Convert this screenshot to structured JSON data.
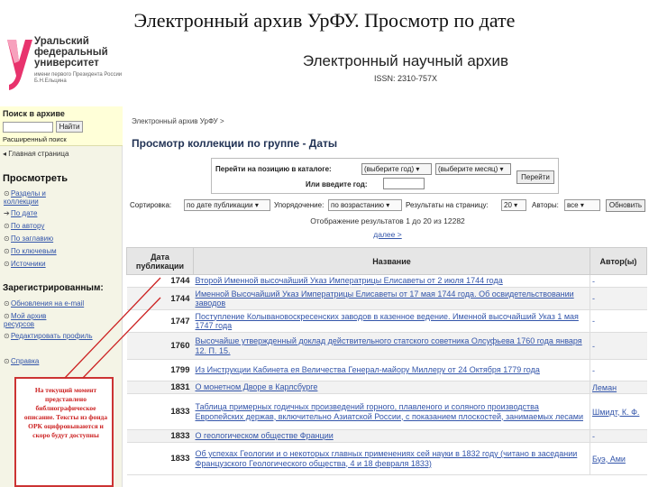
{
  "slide_title": "Электронный архив УрФУ. Просмотр по дате",
  "logo": {
    "lines": [
      "Уральский",
      "федеральный",
      "университет"
    ],
    "sub": "имени первого Президента России Б.Н.Ельцина"
  },
  "banner": {
    "name": "Электронный научный архив",
    "issn": "ISSN: 2310-757X"
  },
  "sidebar": {
    "search_heading": "Поиск в архиве",
    "search_button": "Найти",
    "advanced_search": "Расширенный поиск",
    "home": "Главная страница",
    "browse_heading": "Просмотреть",
    "browse_items": [
      "Разделы и коллекции",
      "По дате",
      "По автору",
      "По заглавию",
      "По ключевым",
      "Источники"
    ],
    "registered_heading": "Зарегистрированным:",
    "registered_items": [
      "Обновления на e-mail",
      "Мой архив ресурсов",
      "Редактировать профиль"
    ],
    "help": "Справка"
  },
  "note": "На текущий момент представлено библиографическое описание. Тексты из фонда ОРК оцифровываются и скоро будут доступны",
  "main": {
    "breadcrumb": "Электронный архив УрФУ >",
    "title": "Просмотр коллекции по группе - Даты",
    "jump": {
      "label_catalog": "Перейти на позицию в каталоге:",
      "year_select": "(выберите год)",
      "month_select": "(выберите месяц)",
      "label_enter": "Или введите год:",
      "go_button": "Перейти"
    },
    "sort": {
      "sort_label": "Сортировка:",
      "sort_value": "по дате публикации",
      "order_label": "Упорядочение:",
      "order_value": "по возрастанию",
      "perpage_label": "Результаты на страницу:",
      "perpage_value": "20",
      "author_label": "Авторы:",
      "author_value": "все",
      "update_button": "Обновить"
    },
    "summary": "Отображение результатов 1 до 20 из 12282",
    "next": "далее >",
    "headers": {
      "date": "Дата публикации",
      "title": "Название",
      "author": "Автор(ы)"
    },
    "rows": [
      {
        "date": "1744",
        "title": "Второй Именной высочайший Указ Императрицы Елисаветы от 2 июля 1744 года",
        "author": "-"
      },
      {
        "date": "1744",
        "title": "Именной Высочайший Указ Императрицы Елисаветы от 17 мая 1744 года. Об освидетельствовании заводов",
        "author": "-"
      },
      {
        "date": "1747",
        "title": "Поступление Колывановоскресенских заводов в казенное ведение. Именной высочайший Указ 1 мая 1747 года",
        "author": "-"
      },
      {
        "date": "1760",
        "title": "Высочайше утвержденный доклад действительного статского советника Олсуфьева 1760 года января 12. П. 15.",
        "author": "-"
      },
      {
        "date": "1799",
        "title": "Из Инструкции Кабинета ея Величества Генерал-майору Миллеру от 24 Октября 1779 года",
        "author": "-"
      },
      {
        "date": "1831",
        "title": "О монетном Дворе в Карлсбурге",
        "author": "Леман"
      },
      {
        "date": "1833",
        "title": "Таблица примерных годичных произведений горного, плавленого и соляного производства Европейских держав, включительно Азиатской России, с показанием плоскостей, занимаемых лесами",
        "author": "Шмидт, К. Ф."
      },
      {
        "date": "1833",
        "title": "О геологическом обществе Франции",
        "author": "-"
      },
      {
        "date": "1833",
        "title": "Об успехах Геологии и о некоторых главных применениях сей науки в 1832 году (читано в заседании Французского Геологического общества, 4 и 18 февраля 1833)",
        "author": "Буэ, Ами"
      }
    ]
  }
}
